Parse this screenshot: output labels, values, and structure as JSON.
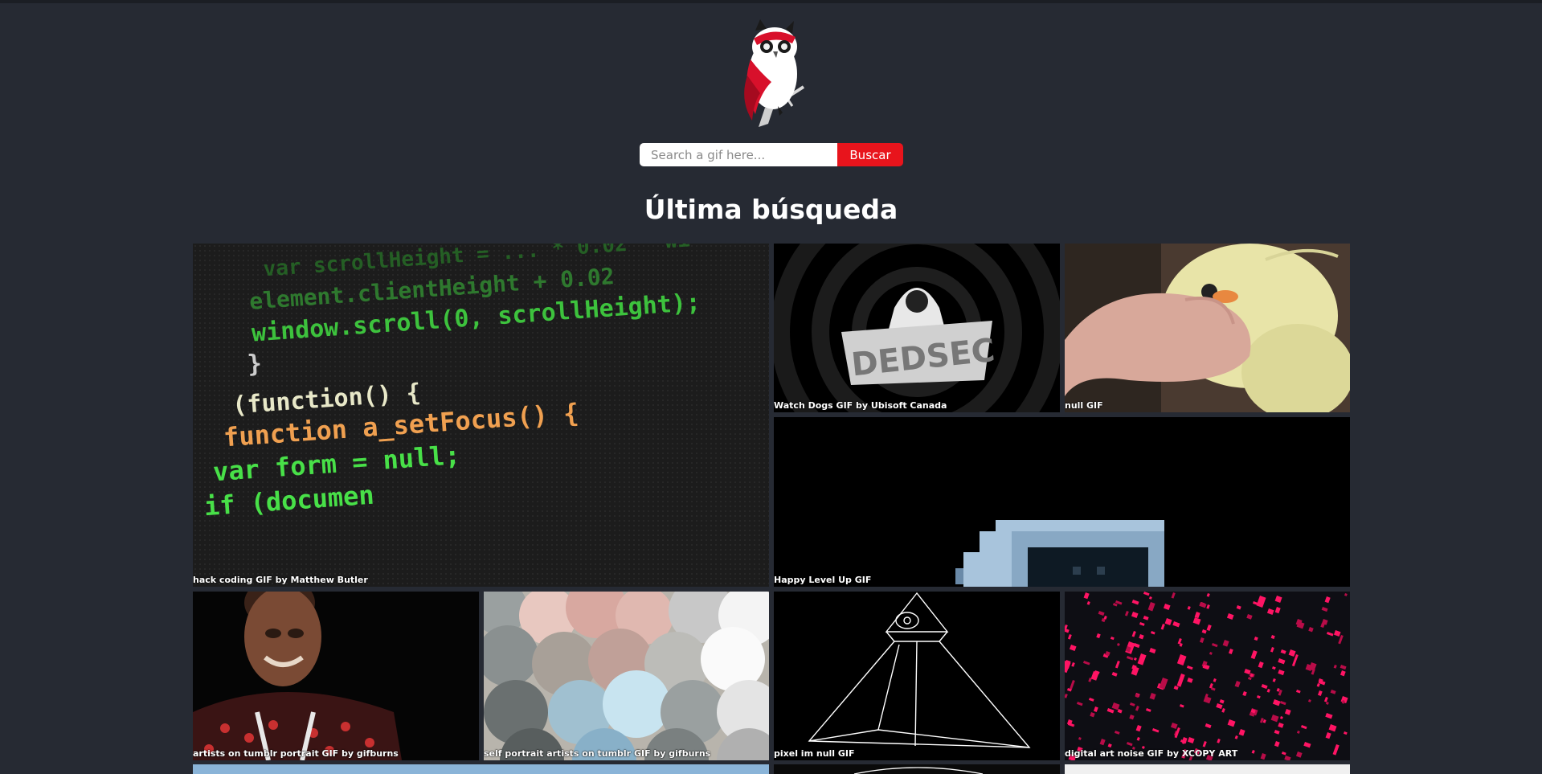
{
  "search": {
    "placeholder": "Search a gif here...",
    "button_label": "Buscar"
  },
  "heading": "Última búsqueda",
  "colors": {
    "background": "#262a33",
    "accent": "#e8141c"
  },
  "logo_icon": "owl-logo-icon",
  "gifs": [
    {
      "title": "hack coding GIF by Matthew Butler"
    },
    {
      "title": "Watch Dogs GIF by Ubisoft Canada"
    },
    {
      "title": "null GIF"
    },
    {
      "title": "Happy Level Up GIF"
    },
    {
      "title": "artists on tumblr portrait GIF by gifburns"
    },
    {
      "title": "self portrait artists on tumblr GIF by gifburns"
    },
    {
      "title": "pixel im null GIF"
    },
    {
      "title": "digital art noise GIF by XCOPY ART"
    }
  ],
  "code_lines": [
    "var scrollHeight = ... * 0.02 * wi",
    "element.clientHeight + 0.02",
    "window.scroll(0, scrollHeight);",
    "}",
    "(function() {",
    "function a_setFocus() {",
    "var form = null;",
    "if (documen"
  ]
}
